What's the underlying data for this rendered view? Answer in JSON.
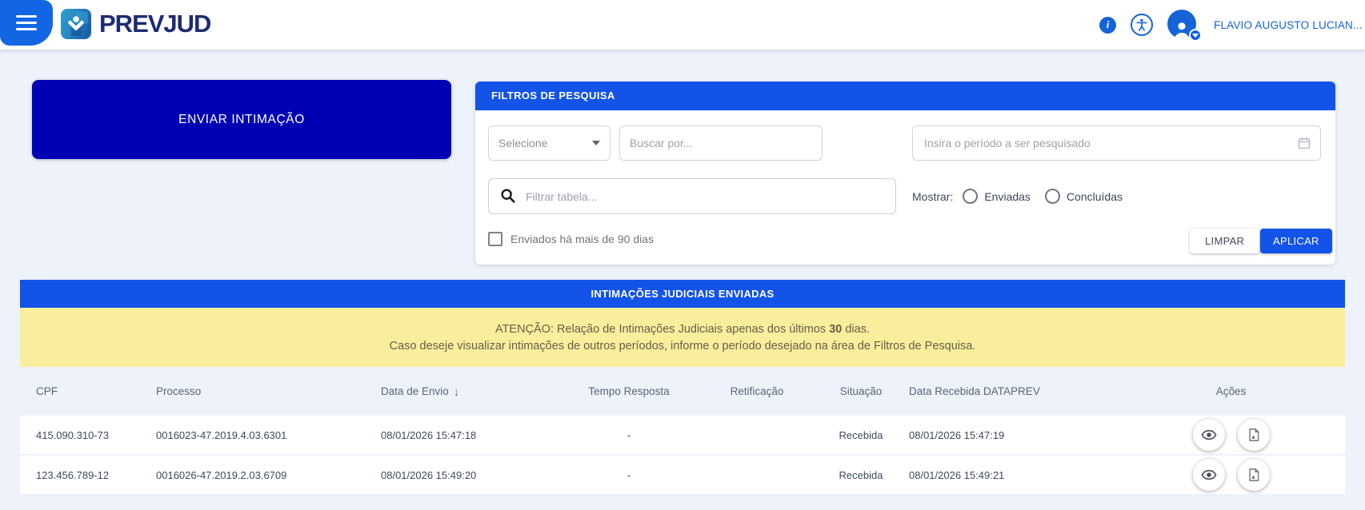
{
  "colors": {
    "accent_blue": "#1353E8",
    "menu_blue": "#1266E3",
    "link_blue": "#1464D8",
    "primary_dark_blue": "#0000B4",
    "brand_navy": "#1D2B72",
    "warning_bg": "#F9EE9C",
    "page_bg": "#EDF2FB"
  },
  "header": {
    "brand": "PREVJUD",
    "user_name": "FLAVIO AUGUSTO LUCIAN...",
    "icons": [
      "menu-icon",
      "brand-logo-icon",
      "info-icon",
      "accessibility-icon",
      "account-icon",
      "chevron-down-icon"
    ]
  },
  "main_action": {
    "send_label": "ENVIAR INTIMAÇÃO"
  },
  "filters": {
    "title": "FILTROS DE PESQUISA",
    "select_placeholder": "Selecione",
    "search_placeholder": "Buscar por...",
    "period_placeholder": "Insira o período a ser pesquisado",
    "table_filter_placeholder": "Filtrar tabela...",
    "show_label": "Mostrar:",
    "radio_options": [
      "Enviadas",
      "Concluídas"
    ],
    "checkbox_label": "Enviados há mais de 90 dias",
    "clear_label": "LIMPAR",
    "apply_label": "APLICAR"
  },
  "table": {
    "title": "INTIMAÇÕES JUDICIAIS ENVIADAS",
    "warning_line1_prefix": "ATENÇÃO: Relação de Intimações Judiciais apenas dos últimos ",
    "warning_days": "30",
    "warning_line1_suffix": " dias.",
    "warning_line2": "Caso deseje visualizar intimações de outros períodos, informe o período desejado na área de Filtros de Pesquisa.",
    "columns": [
      "CPF",
      "Processo",
      "Data de Envio",
      "Tempo Resposta",
      "Retificação",
      "Situação",
      "Data Recebida DATAPREV",
      "Ações"
    ],
    "sort_icon": "↓",
    "rows": [
      {
        "cpf": "415.090.310-73",
        "processo": "0016023-47.2019.4.03.6301",
        "data_envio": "08/01/2026 15:47:18",
        "tempo_resposta": "-",
        "retificacao": "",
        "situacao": "Recebida",
        "data_recebida": "08/01/2026 15:47:19"
      },
      {
        "cpf": "123.456.789-12",
        "processo": "0016026-47.2019.2.03.6709",
        "data_envio": "08/01/2026 15:49:20",
        "tempo_resposta": "-",
        "retificacao": "",
        "situacao": "Recebida",
        "data_recebida": "08/01/2026 15:49:21"
      }
    ]
  }
}
